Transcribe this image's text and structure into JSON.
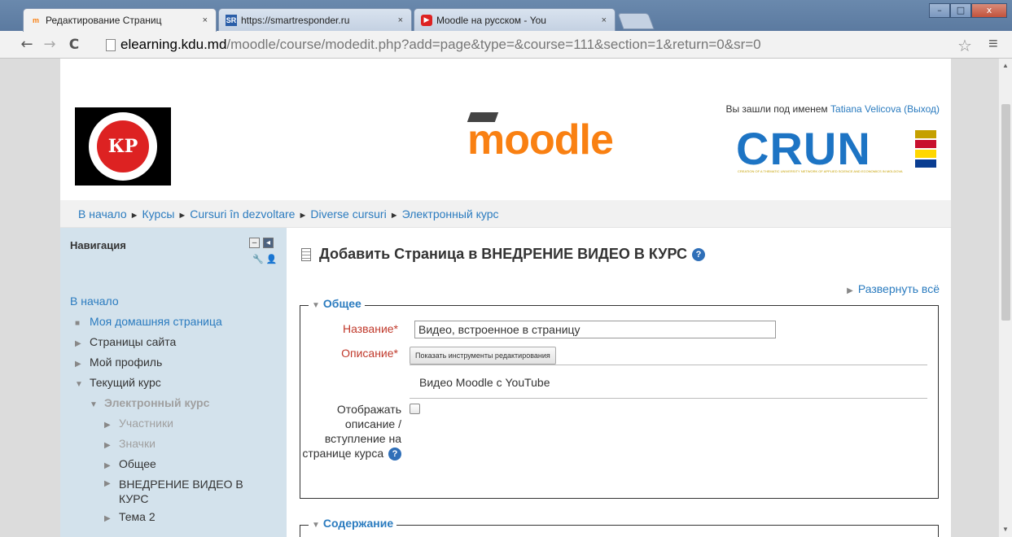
{
  "browser": {
    "tabs": [
      {
        "title": "Редактирование Страниц",
        "favicon": "moodle-favicon"
      },
      {
        "title": "https://smartresponder.ru",
        "favicon": "sr-favicon"
      },
      {
        "title": "Moodle на русском - You",
        "favicon": "youtube-favicon"
      }
    ],
    "tab_close": "×",
    "url_host": "elearning.kdu.md",
    "url_path": "/moodle/course/modedit.php?add=page&type=&course=111&section=1&return=0&sr=0",
    "window_buttons": {
      "minimize": "–",
      "maximize": "□",
      "close": "x"
    },
    "nav": {
      "back": "←",
      "forward": "→",
      "reload": "C",
      "star": "☆",
      "menu": "≡"
    }
  },
  "header": {
    "login_prefix": "Вы зашли под именем ",
    "user_name": "Tatiana Velicova",
    "logout": "(Выход)",
    "kdu_logo_text": "КР",
    "moodle_logo": "moodle",
    "crun_logo": "CRUN",
    "crun_tagline": "CREATION OF A THEMATIC UNIVERSITY NETWORK OF APPLIED SCIENCE AND ECONOMICS IN MOLDOVA"
  },
  "breadcrumb": [
    "В начало",
    "Курсы",
    "Cursuri în dezvoltare",
    "Diverse cursuri",
    "Электронный курс"
  ],
  "breadcrumb_sep": "►",
  "sidebar": {
    "title": "Навигация",
    "items": [
      {
        "label": "В начало",
        "bullet": ""
      },
      {
        "label": "Моя домашняя страница",
        "bullet": "■"
      },
      {
        "label": "Страницы сайта",
        "bullet": "▶"
      },
      {
        "label": "Мой профиль",
        "bullet": "▶"
      },
      {
        "label": "Текущий курс",
        "bullet": "▼"
      },
      {
        "label": "Электронный курс",
        "bullet": "▼"
      },
      {
        "label": "Участники",
        "bullet": "▶"
      },
      {
        "label": "Значки",
        "bullet": "▶"
      },
      {
        "label": "Общее",
        "bullet": "▶"
      },
      {
        "label": "ВНЕДРЕНИЕ ВИДЕО В КУРС",
        "bullet": "▶"
      },
      {
        "label": "Тема 2",
        "bullet": "▶"
      }
    ]
  },
  "main": {
    "heading": "Добавить Страница в ВНЕДРЕНИЕ ВИДЕО В КУРС",
    "expand_all": "Развернуть всё",
    "section_general": "Общее",
    "section_content": "Содержание",
    "name_label": "Название",
    "name_value": "Видео, встроенное в страницу",
    "description_label": "Описание",
    "editor_tools_button": "Показать инструменты редактирования",
    "description_value": "Видео Moodle с YouTube",
    "show_description_label": "Отображать описание / вступление на странице курса",
    "required_mark": "*",
    "help_mark": "?"
  },
  "colors": {
    "link": "#2a7bbf",
    "required": "#c0392b",
    "sidebar_bg": "#d3e2ec",
    "moodle_orange": "#f98012",
    "crun_blue": "#1d74c4"
  }
}
